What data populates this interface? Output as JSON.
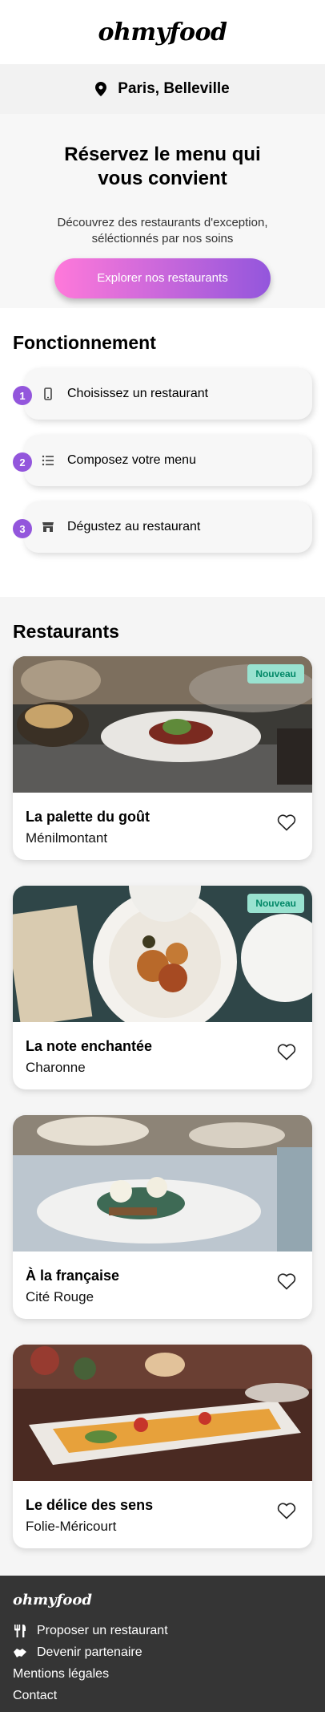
{
  "header": {
    "logo": "ohmyfood"
  },
  "location": {
    "label": "Paris, Belleville",
    "icon": "map-pin-icon"
  },
  "hero": {
    "title": "Réservez le menu qui vous convient",
    "subtitle": "Découvrez des restaurants d'exception, séléctionnés par nos soins",
    "cta_label": "Explorer nos restaurants"
  },
  "how": {
    "title": "Fonctionnement",
    "steps": [
      {
        "num": "1",
        "label": "Choisissez un restaurant",
        "icon": "mobile-phone-icon"
      },
      {
        "num": "2",
        "label": "Composez votre menu",
        "icon": "list-icon"
      },
      {
        "num": "3",
        "label": "Dégustez au restaurant",
        "icon": "store-icon"
      }
    ]
  },
  "restaurants": {
    "title": "Restaurants",
    "items": [
      {
        "name": "La palette du goût",
        "area": "Ménilmontant",
        "badge": "Nouveau"
      },
      {
        "name": "La note enchantée",
        "area": "Charonne",
        "badge": "Nouveau"
      },
      {
        "name": "À la française",
        "area": "Cité Rouge"
      },
      {
        "name": "Le délice des sens",
        "area": "Folie-Méricourt"
      }
    ]
  },
  "footer": {
    "logo": "ohmyfood",
    "links": [
      {
        "label": "Proposer un restaurant",
        "icon": "utensils-icon"
      },
      {
        "label": "Devenir partenaire",
        "icon": "handshake-icon"
      },
      {
        "label": "Mentions légales"
      },
      {
        "label": "Contact"
      }
    ]
  },
  "colors": {
    "accent_start": "#ff79da",
    "accent_end": "#9356dc",
    "badge_bg": "#99e2d0",
    "badge_text": "#008766",
    "footer_bg": "#353535"
  }
}
